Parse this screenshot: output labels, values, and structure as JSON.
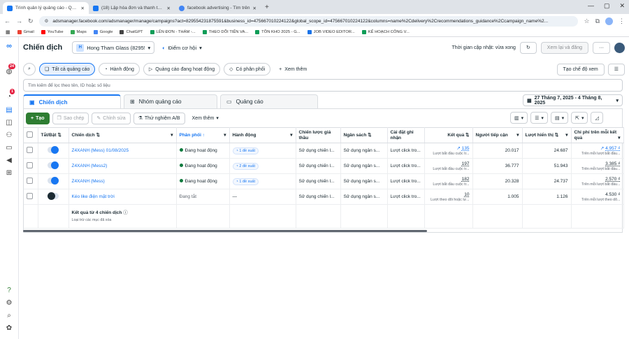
{
  "browser": {
    "tabs": [
      {
        "title": "Trình quản lý quảng cáo - Quản",
        "color": "#1877f2"
      },
      {
        "title": "(18) Lập hóa đơn và thanh toán",
        "color": "#1877f2"
      },
      {
        "title": "facebook advertising - Tìm trên",
        "color": "#4285f4"
      }
    ],
    "url": "adsmanager.facebook.com/adsmanager/manage/campaigns?act=829554231875591&business_id=475667010224122&global_scope_id=475667010224122&columns=name%2Cdelivery%2Crecommendations_guidance%2Ccampaign_name%2...",
    "bookmarks": [
      {
        "label": "Gmail",
        "color": "#ea4335"
      },
      {
        "label": "YouTube",
        "color": "#ff0000"
      },
      {
        "label": "Maps",
        "color": "#34a853"
      },
      {
        "label": "Google",
        "color": "#4285f4"
      },
      {
        "label": "ChatGPT",
        "color": "#444444"
      },
      {
        "label": "LÊN ĐƠN - THẨM -...",
        "color": "#0f9d58"
      },
      {
        "label": "THEO DÕI TIẾN VA...",
        "color": "#0f9d58"
      },
      {
        "label": "TỒN KHO 2025 - G...",
        "color": "#0f9d58"
      },
      {
        "label": "JOB VIDEO EDITOR...",
        "color": "#1a73e8"
      },
      {
        "label": "KẾ HOẠCH CÔNG V...",
        "color": "#0f9d58"
      }
    ]
  },
  "sidebar": {
    "notif_count": "24",
    "alert_count": "1"
  },
  "header": {
    "title": "Chiến dịch",
    "account_initial": "H",
    "account_name": "Hong Tham Glass (82955...",
    "opportunity": "Điểm cơ hội",
    "updated": "Thời gian cập nhật: vừa xong",
    "review_btn": "Xem lại và đăng",
    "more": "···"
  },
  "filters": {
    "items": [
      "Tất cả quảng cáo",
      "Hành động",
      "Quảng cáo đang hoạt động",
      "Có phân phối"
    ],
    "more": "Xem thêm",
    "view_mode": "Tạo chế độ xem"
  },
  "search": {
    "placeholder": "Tìm kiếm để lọc theo tên, ID hoặc số liệu"
  },
  "levels": [
    "Chiến dịch",
    "Nhóm quảng cáo",
    "Quảng cáo"
  ],
  "date_range": "27 Tháng 7, 2025 - 4 Tháng 8, 2025",
  "toolbar": {
    "create": "Tạo",
    "copy": "Sao chép",
    "edit": "Chỉnh sửa",
    "ab": "Thử nghiệm A/B",
    "more": "Xem thêm"
  },
  "columns": [
    "Tắt/Bật",
    "Chiến dịch",
    "Phân phối",
    "Hành động",
    "Chiến lược giá thầu",
    "Ngân sách",
    "Cài đặt ghi nhận",
    "Kết quả",
    "Người tiếp cận",
    "Lượt hiển thị",
    "Chi phí trên mỗi kết quả"
  ],
  "rows": [
    {
      "name": "Z4XANH (Mess) 01/08/2025",
      "on": true,
      "delivery": "Đang hoạt động",
      "action": "1 đề xuất",
      "bid": "Sử dụng chiến l...",
      "budget": "Sử dụng ngân s...",
      "attribution": "Lượt click tro...",
      "results": "135",
      "results_sub": "Lượt bắt đầu cuộc tr...",
      "reach": "20.017",
      "impressions": "24.687",
      "cpr": "4.957 ₫",
      "cpr_sub": "Trên mỗi lượt bắt đầu..."
    },
    {
      "name": "Z4XANH (Mess2)",
      "on": true,
      "delivery": "Đang hoạt động",
      "action": "2 đề xuất",
      "bid": "Sử dụng chiến l...",
      "budget": "Sử dụng ngân s...",
      "attribution": "Lượt click tro...",
      "results": "197",
      "results_sub": "Lượt bắt đầu cuộc tr...",
      "reach": "36.777",
      "impressions": "51.943",
      "cpr": "3.385 ₫",
      "cpr_sub": "Trên mỗi lượt bắt đầu..."
    },
    {
      "name": "Z4XANH (Mess)",
      "on": true,
      "delivery": "Đang hoạt động",
      "action": "1 đề xuất",
      "bid": "Sử dụng chiến l...",
      "budget": "Sử dụng ngân s...",
      "attribution": "Lượt click tro...",
      "results": "182",
      "results_sub": "Lượt bắt đầu cuộc tr...",
      "reach": "20.328",
      "impressions": "24.737",
      "cpr": "2.570 ₫",
      "cpr_sub": "Trên mỗi lượt bắt đầu..."
    },
    {
      "name": "Kéo like điện mặt trời",
      "on": false,
      "delivery": "Đang tắt",
      "action": "—",
      "bid": "Sử dụng chiến l...",
      "budget": "Sử dụng ngân s...",
      "attribution": "Lượt click tro...",
      "results": "10",
      "results_sub": "Lượt theo dõi hoặc lư...",
      "reach": "1.005",
      "impressions": "1.126",
      "cpr": "4.530 ₫",
      "cpr_sub": "Trên mỗi lượt theo dõ..."
    }
  ],
  "summary": {
    "title": "Kết quả từ 4 chiến dịch",
    "note": "Loại trừ các mục đã xóa"
  }
}
